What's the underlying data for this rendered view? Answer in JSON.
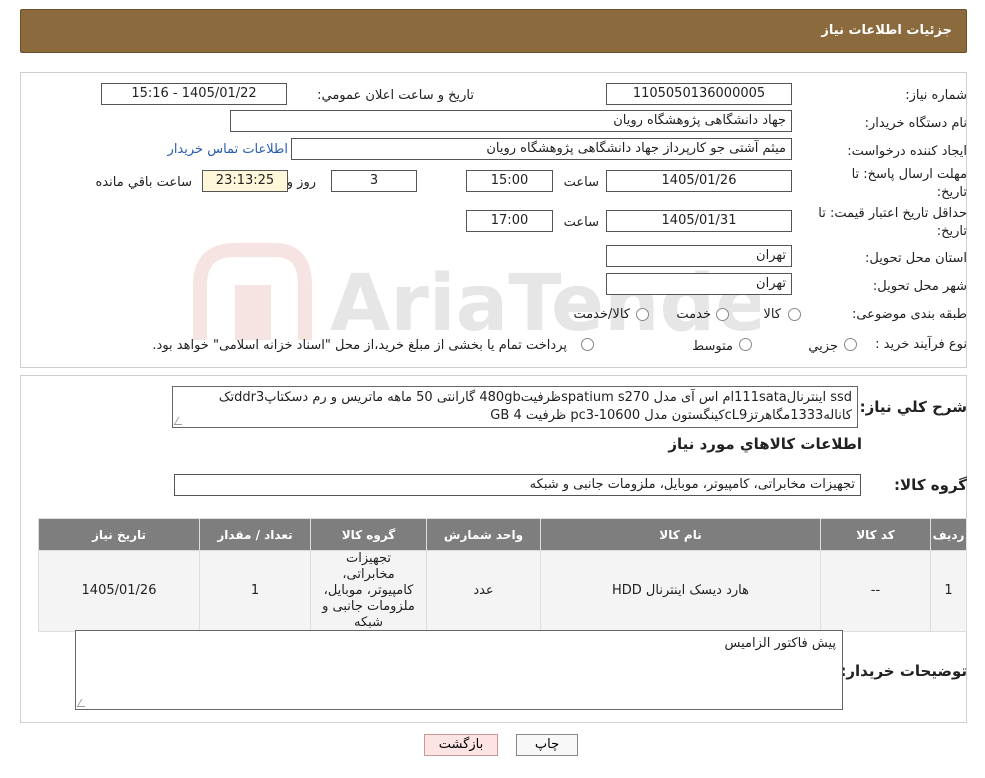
{
  "header": {
    "title": "جزئیات اطلاعات نیاز"
  },
  "form": {
    "need_number_label": "شماره نیاز:",
    "need_number": "1105050136000005",
    "announce_label": "تاریخ و ساعت اعلان عمومي:",
    "announce_value": "1405/01/22 - 15:16",
    "buyer_org_label": "نام دستگاه خريدار:",
    "buyer_org": "جهاد دانشگاهی پژوهشگاه رويان",
    "requester_label": "ايجاد کننده درخواست:",
    "requester": "میثم  آشتی جو کارپرداز جهاد دانشگاهی پژوهشگاه رويان",
    "contact_link": "اطلاعات تماس خريدار",
    "reply_deadline_label": "مهلت ارسال پاسخ: تا تاريخ:",
    "reply_date": "1405/01/26",
    "time_label": "ساعت",
    "reply_time": "15:00",
    "days_value": "3",
    "days_label": "روز و",
    "remaining_time": "23:13:25",
    "remaining_label": "ساعت باقي مانده",
    "price_valid_label": "حداقل تاريخ اعتبار قيمت: تا تاريخ:",
    "price_valid_date": "1405/01/31",
    "price_valid_time": "17:00",
    "province_label": "استان محل تحويل:",
    "province": "تهران",
    "city_label": "شهر محل تحويل:",
    "city": "تهران",
    "category_label": "طبقه بندی موضوعی:",
    "category_options": [
      "کالا",
      "خدمت",
      "کالا/خدمت"
    ],
    "process_label": "نوع فرآيند خريد :",
    "process_options": [
      "جزيي",
      "متوسط"
    ],
    "process_note": "پرداخت تمام يا بخشی از مبلغ خريد،از محل \"اسناد خزانه اسلامی\" خواهد بود."
  },
  "summary": {
    "desc_label": "شرح کلي نياز:",
    "desc_line1": "ssd اینترنال111sataام اس آی مدل spatium s270ظرفیت480gb گارانتی 50 ماهه ماتریس و رم دسکتاپddr3تک",
    "desc_line2": "کاناله1333مگاهرتزcL9کینگستون مدل pc3-10600 ظرفیت 4 GB",
    "goods_info_title": "اطلاعات کالاهاي مورد نياز",
    "goods_group_label": "گروه کالا:",
    "goods_group": "تجهيزات مخابراتی، کامپيوتر، موبايل، ملزومات جانبی و شبکه"
  },
  "table": {
    "headers": [
      "رديف",
      "کد کالا",
      "نام کالا",
      "واحد شمارش",
      "گروه کالا",
      "تعداد / مقدار",
      "تاريخ نياز"
    ],
    "rows": [
      {
        "row": "1",
        "code": "--",
        "name": "هارد دیسک اینترنال HDD",
        "unit": "عدد",
        "group": "تجهيزات مخابراتی، کامپيوتر، موبايل، ملزومات جانبی و شبکه",
        "qty": "1",
        "date": "1405/01/26"
      }
    ]
  },
  "notes": {
    "label": "توضيحات خريدار:",
    "value": "پیش فاکتور الزامیس"
  },
  "buttons": {
    "print": "چاپ",
    "back": "بازگشت"
  },
  "watermark_text": "AriaTender.neT",
  "colors": {
    "header_bg": "#8b6a3e",
    "table_header_bg": "#7e7e7e",
    "link": "#2a5db0"
  }
}
